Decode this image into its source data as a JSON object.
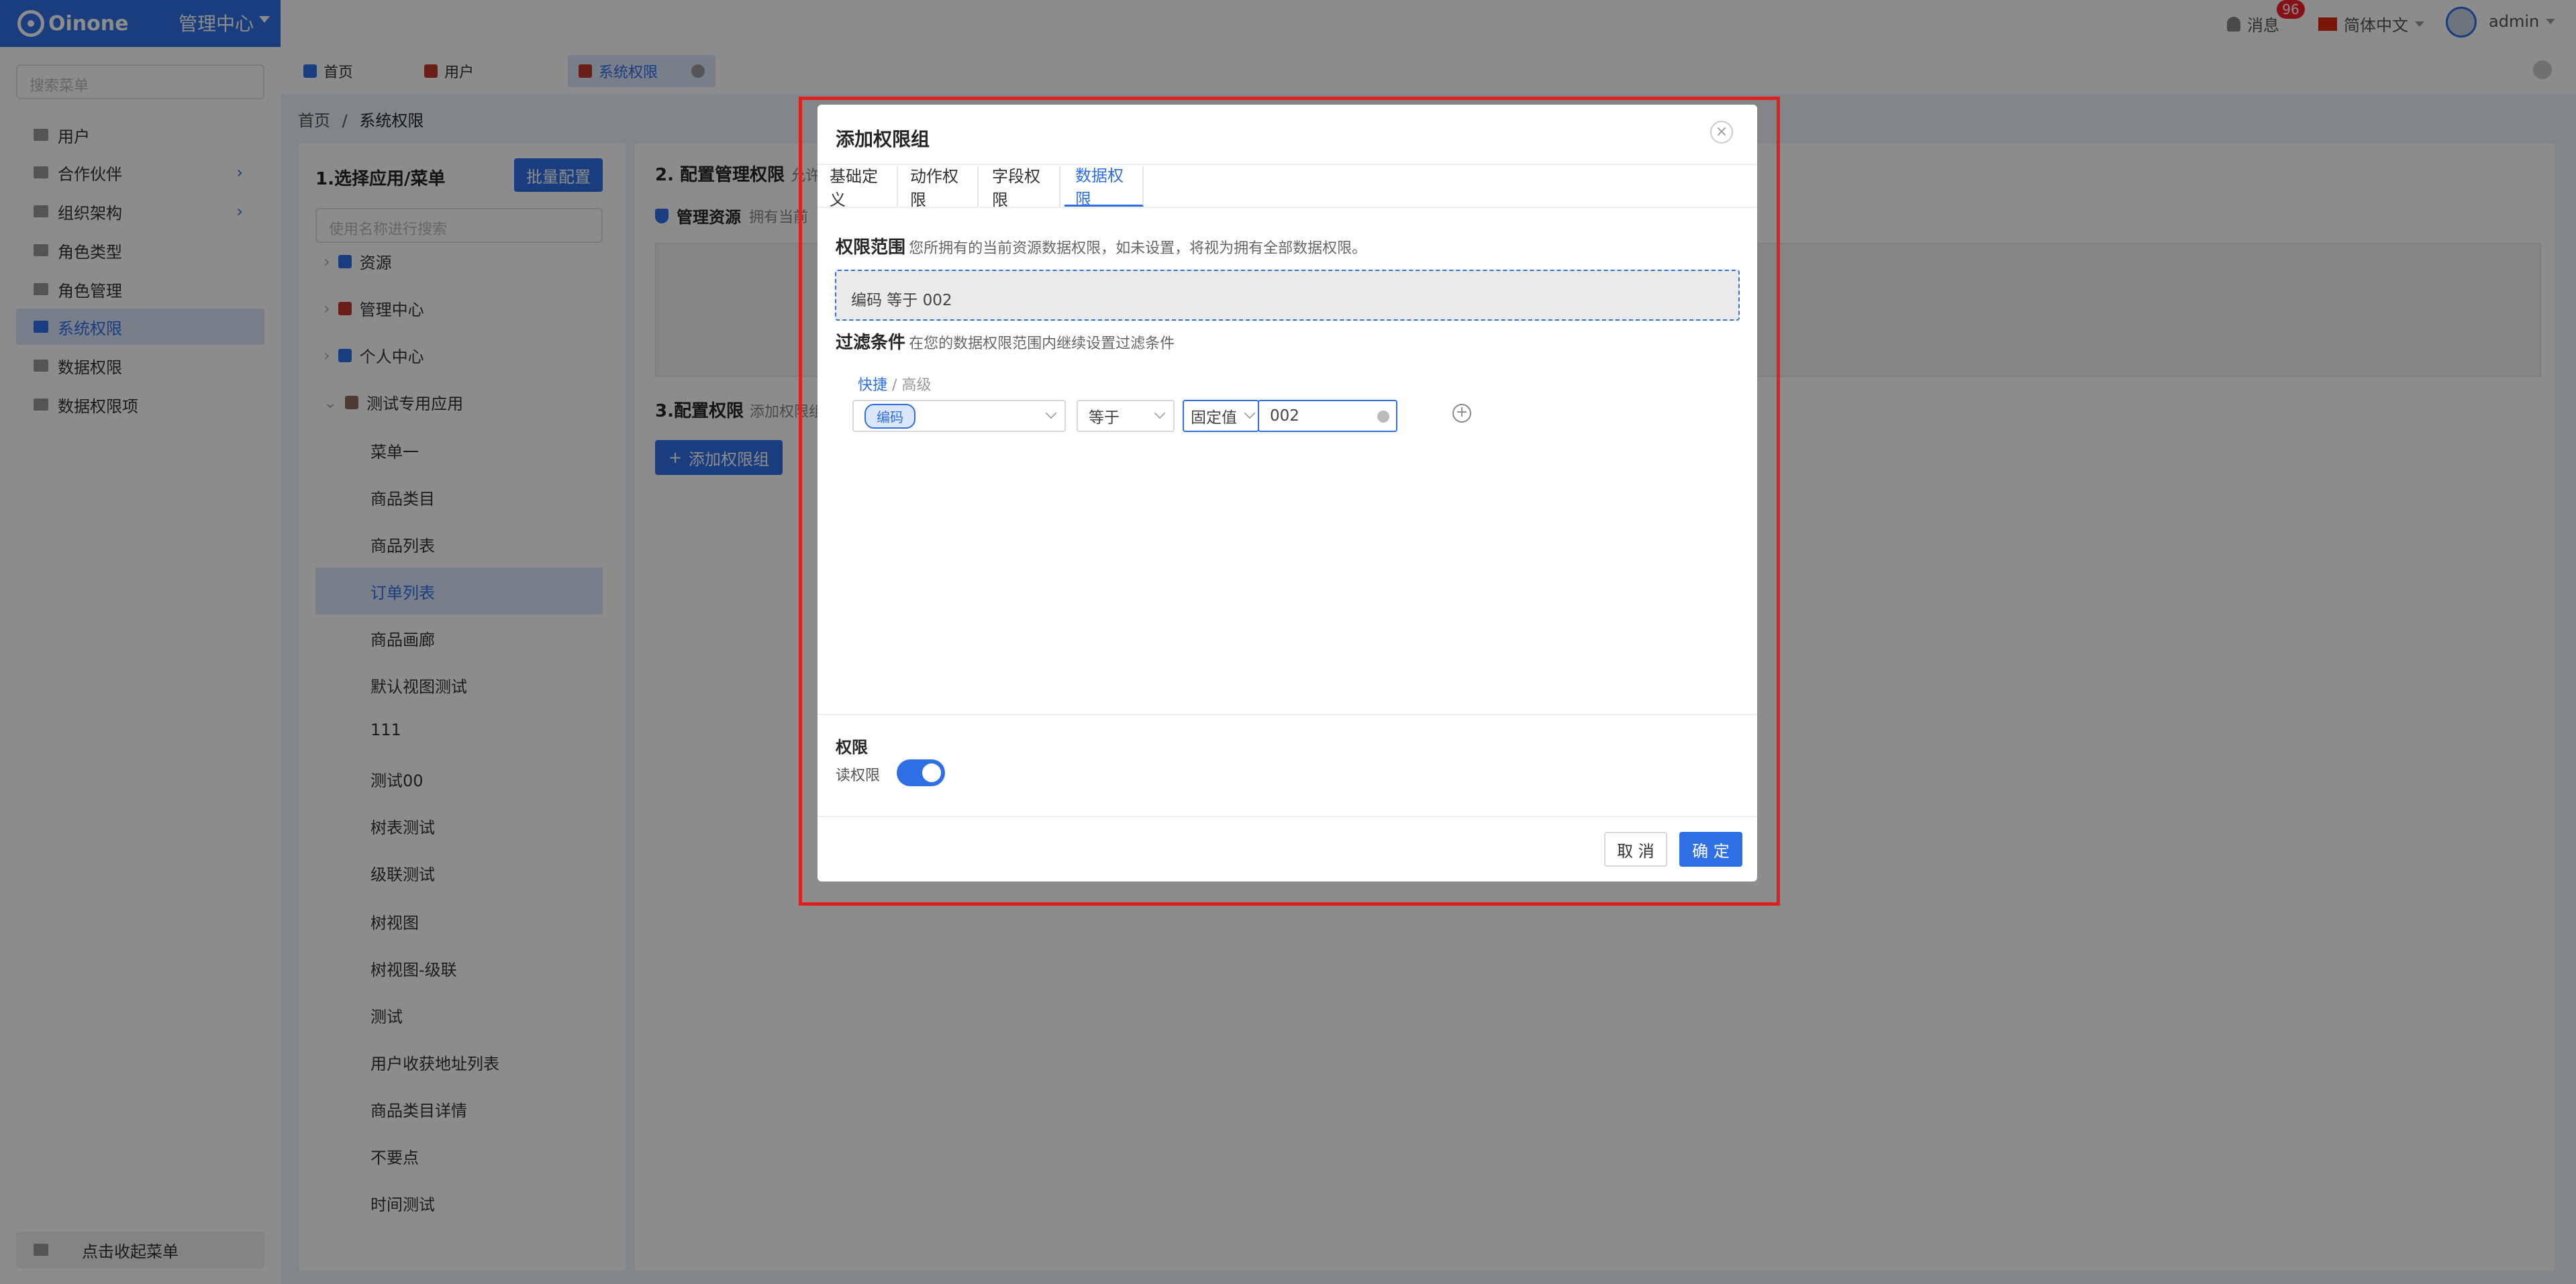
{
  "app": {
    "logo": "Oinone",
    "app_name": "管理中心"
  },
  "topbar": {
    "messages_label": "消息",
    "messages_badge": "96",
    "language": "简体中文",
    "user": "admin"
  },
  "sidebar": {
    "search_placeholder": "搜索菜单",
    "items": [
      {
        "label": "用户"
      },
      {
        "label": "合作伙伴"
      },
      {
        "label": "组织架构"
      },
      {
        "label": "角色类型"
      },
      {
        "label": "角色管理"
      },
      {
        "label": "系统权限"
      },
      {
        "label": "数据权限"
      },
      {
        "label": "数据权限项"
      }
    ],
    "collapse_label": "点击收起菜单"
  },
  "page_tabs": [
    {
      "label": "首页"
    },
    {
      "label": "用户"
    },
    {
      "label": "系统权限"
    }
  ],
  "breadcrumb": {
    "home": "首页",
    "sep": "/",
    "current": "系统权限"
  },
  "panel1": {
    "title": "1.选择应用/菜单",
    "batch_button": "批量配置",
    "search_placeholder": "使用名称进行搜索",
    "tree": [
      {
        "label": "资源"
      },
      {
        "label": "管理中心"
      },
      {
        "label": "个人中心"
      },
      {
        "label": "测试专用应用"
      }
    ],
    "leaves": [
      "菜单一",
      "商品类目",
      "商品列表",
      "订单列表",
      "商品画廊",
      "默认视图测试",
      "111",
      "测试00",
      "树表测试",
      "级联测试",
      "树视图",
      "树视图-级联",
      "测试",
      "用户收获地址列表",
      "商品类目详情",
      "不要点",
      "时间测试"
    ]
  },
  "panel2": {
    "section2_title": "2. 配置管理权限",
    "section2_hint": "允许",
    "mgmt_label": "管理资源",
    "mgmt_hint": "拥有当前",
    "section3_title": "3.配置权限",
    "section3_hint": "添加权限组",
    "add_group_button": "添加权限组"
  },
  "dialog": {
    "title": "添加权限组",
    "tabs": [
      "基础定义",
      "动作权限",
      "字段权限",
      "数据权限"
    ],
    "scope_label": "权限范围",
    "scope_hint": "您所拥有的当前资源数据权限，如未设置，将视为拥有全部数据权限。",
    "scope_value": "编码 等于 002",
    "filter_label": "过滤条件",
    "filter_hint": "在您的数据权限范围内继续设置过滤条件",
    "mode_quick": "快捷",
    "mode_sep": "/",
    "mode_advanced": "高级",
    "field_chip": "编码",
    "operator": "等于",
    "value_type": "固定值",
    "value": "002",
    "perm_label": "权限",
    "read_label": "读权限",
    "read_enabled": true,
    "cancel": "取 消",
    "ok": "确 定"
  },
  "colors": {
    "primary": "#2f6fe6",
    "highlight": "#e02020"
  }
}
